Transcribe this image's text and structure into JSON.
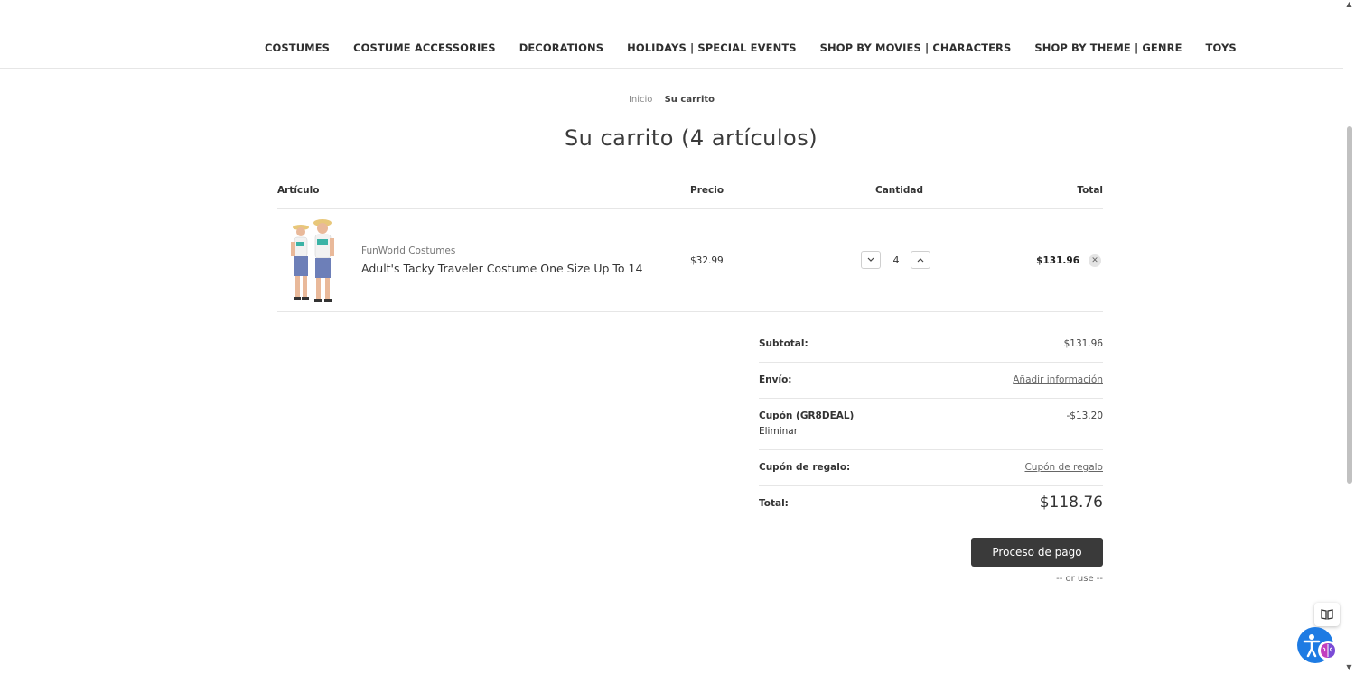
{
  "nav": {
    "items": [
      "COSTUMES",
      "COSTUME ACCESSORIES",
      "DECORATIONS",
      "HOLIDAYS | SPECIAL EVENTS",
      "SHOP BY MOVIES | CHARACTERS",
      "SHOP BY THEME | GENRE",
      "TOYS"
    ]
  },
  "breadcrumb": {
    "home": "Inicio",
    "current": "Su carrito"
  },
  "title": "Su carrito (4 artículos)",
  "table": {
    "headers": {
      "item": "Artículo",
      "price": "Precio",
      "quantity": "Cantidad",
      "total": "Total"
    }
  },
  "cart_item": {
    "brand": "FunWorld Costumes",
    "name": "Adult's Tacky Traveler Costume One Size Up To 14",
    "price": "$32.99",
    "quantity": "4",
    "line_total": "$131.96",
    "decrease_icon": "chevron-down-icon",
    "increase_icon": "chevron-up-icon",
    "remove_icon": "close-icon"
  },
  "totals": {
    "subtotal_label": "Subtotal:",
    "subtotal_value": "$131.96",
    "shipping_label": "Envío:",
    "shipping_link": "Añadir información",
    "coupon_label": "Cupón (GR8DEAL)",
    "coupon_remove": "Eliminar",
    "coupon_value": "-$13.20",
    "gift_label": "Cupón de regalo:",
    "gift_link": "Cupón de regalo",
    "grand_label": "Total:",
    "grand_value": "$118.76"
  },
  "checkout": {
    "button": "Proceso de pago",
    "or_use": "-- or use --"
  },
  "colors": {
    "checkout_bg": "#3a3a3a",
    "accessibility_bg": "#1e7be3",
    "divider": "#e6e6e6"
  }
}
